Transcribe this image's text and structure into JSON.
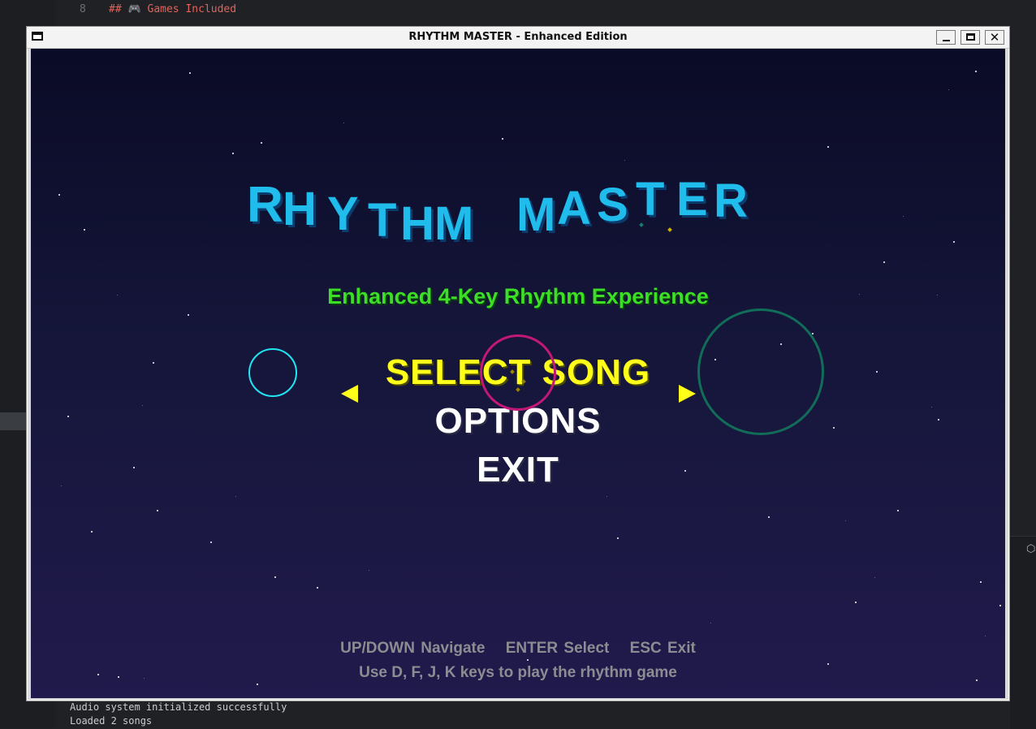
{
  "editor": {
    "line_number": "8",
    "line_text": "## 🎮 Games Included"
  },
  "terminal": {
    "lines": [
      "Audio system initialized successfully",
      "Loaded 2 songs"
    ]
  },
  "window": {
    "title": "RHYTHM MASTER - Enhanced Edition",
    "close_glyph": "✕"
  },
  "game": {
    "title_letters": [
      "R",
      "H",
      "Y",
      "T",
      "H",
      "M",
      "M",
      "A",
      "S",
      "T",
      "E",
      "R"
    ],
    "subtitle": "Enhanced 4-Key Rhythm Experience",
    "menu": {
      "items": [
        "SELECT SONG",
        "OPTIONS",
        "EXIT"
      ],
      "selected_index": 0
    },
    "help": {
      "controls": [
        "UP/DOWN Navigate",
        "ENTER Select",
        "ESC Exit"
      ],
      "keys_hint": "Use D, F, J, K keys to play the rhythm game"
    },
    "colors": {
      "title": "#1fbcec",
      "subtitle": "#3dde26",
      "selected": "#ffff19",
      "menu": "#ffffff",
      "help": "#8d8c92",
      "ring_cyan": "#22e5f2",
      "ring_pink": "#c21876",
      "ring_green": "#116d58"
    }
  }
}
